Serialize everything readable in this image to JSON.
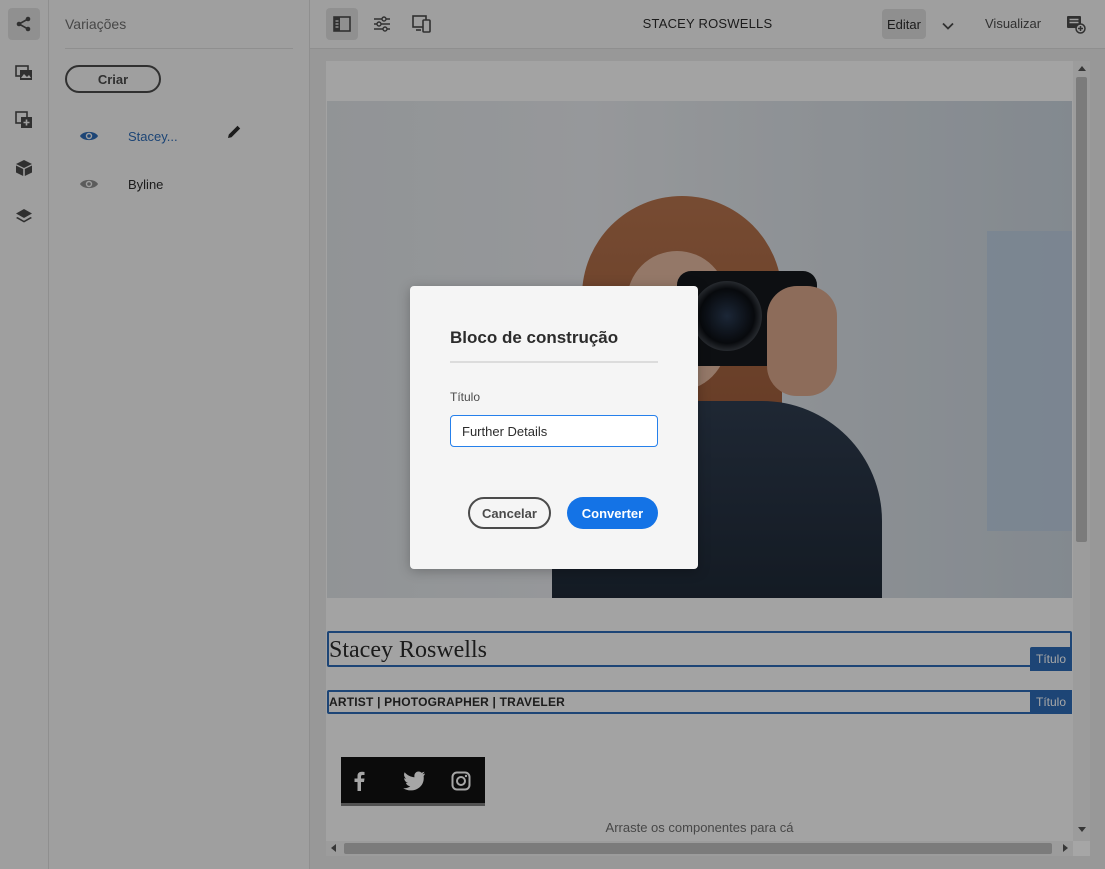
{
  "rail": {
    "items": [
      {
        "icon": "share-variations-icon",
        "active": true
      },
      {
        "icon": "assets-icon",
        "active": false
      },
      {
        "icon": "add-component-icon",
        "active": false
      },
      {
        "icon": "box-icon",
        "active": false
      },
      {
        "icon": "layers-icon",
        "active": false
      }
    ]
  },
  "panel": {
    "title": "Variações",
    "create_label": "Criar",
    "variations": [
      {
        "label": "Stacey...",
        "active": true,
        "color": "#2d6bb5"
      },
      {
        "label": "Byline",
        "active": false,
        "color": "#2c2c2c"
      }
    ]
  },
  "topbar": {
    "page_title": "STACEY ROSWELLS",
    "edit_label": "Editar",
    "preview_label": "Visualizar"
  },
  "canvas": {
    "title_text": "Stacey Roswells",
    "title_badge": "Título",
    "subtitle_text": "ARTIST | PHOTOGRAPHER | TRAVELER",
    "subtitle_badge": "Título",
    "social_icons": [
      "facebook-icon",
      "twitter-icon",
      "instagram-icon"
    ],
    "drop_text": "Arraste os componentes para cá"
  },
  "dialog": {
    "title": "Bloco de construção",
    "field_label": "Título",
    "field_value": "Further Details",
    "cancel_label": "Cancelar",
    "convert_label": "Converter"
  },
  "colors": {
    "accent": "#1473e6",
    "selection": "#2d6bb5"
  }
}
